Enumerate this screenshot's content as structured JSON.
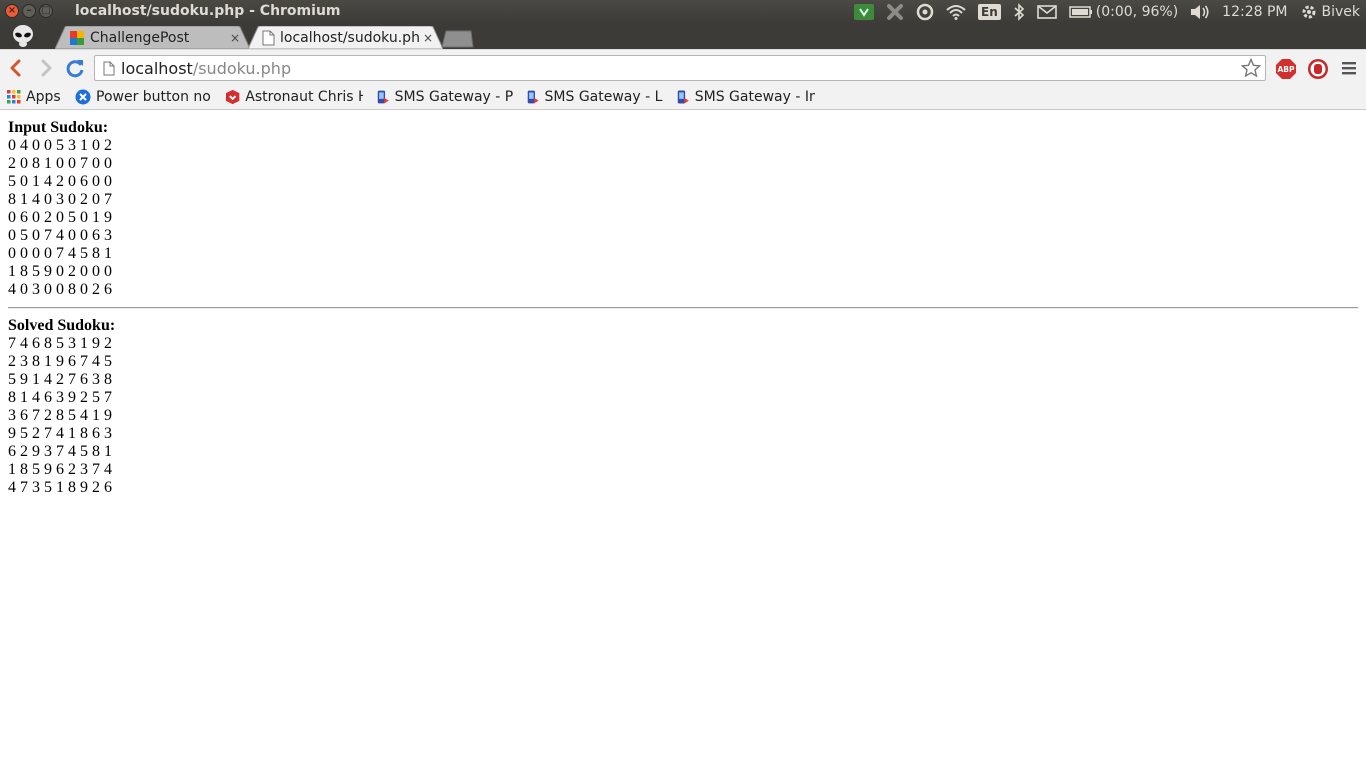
{
  "system": {
    "window_title": "localhost/sudoku.php - Chromium",
    "keyboard": "En",
    "battery": "(0:00, 96%)",
    "clock": "12:28 PM",
    "user": "Bivek"
  },
  "tabs": [
    {
      "title": "ChallengePost",
      "close": "×"
    },
    {
      "title": "localhost/sudoku.php",
      "close": "×"
    }
  ],
  "address_bar": {
    "host": "localhost",
    "path": "/sudoku.php"
  },
  "extensions": {
    "adblock": "ABP"
  },
  "bookmarks": [
    {
      "label": "Apps"
    },
    {
      "label": "Power button no"
    },
    {
      "label": "Astronaut Chris H"
    },
    {
      "label": "SMS Gateway - PH"
    },
    {
      "label": "SMS Gateway - Lin"
    },
    {
      "label": "SMS Gateway - Ins"
    }
  ],
  "content": {
    "input_title": "Input Sudoku:",
    "input_rows": [
      "0 4 0 0 5 3 1 0 2",
      "2 0 8 1 0 0 7 0 0",
      "5 0 1 4 2 0 6 0 0",
      "8 1 4 0 3 0 2 0 7",
      "0 6 0 2 0 5 0 1 9",
      "0 5 0 7 4 0 0 6 3",
      "0 0 0 0 7 4 5 8 1",
      "1 8 5 9 0 2 0 0 0",
      "4 0 3 0 0 8 0 2 6"
    ],
    "solved_title": "Solved Sudoku:",
    "solved_rows": [
      "7 4 6 8 5 3 1 9 2",
      "2 3 8 1 9 6 7 4 5",
      "5 9 1 4 2 7 6 3 8",
      "8 1 4 6 3 9 2 5 7",
      "3 6 7 2 8 5 4 1 9",
      "9 5 2 7 4 1 8 6 3",
      "6 2 9 3 7 4 5 8 1",
      "1 8 5 9 6 2 3 7 4",
      "4 7 3 5 1 8 9 2 6"
    ]
  }
}
